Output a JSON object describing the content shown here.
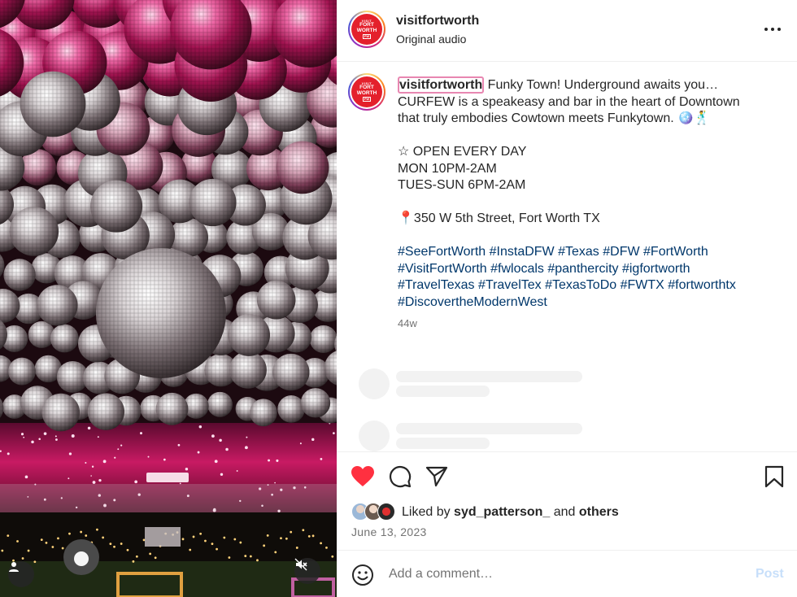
{
  "header": {
    "username": "visitfortworth",
    "audio": "Original audio",
    "more_icon": "more-horizontal-icon"
  },
  "avatar": {
    "line1": "VISIT",
    "line2": "FORT",
    "line3": "WORTH",
    "line4": "FW",
    "color": "#e4202c"
  },
  "caption": {
    "username": "visitfortworth",
    "line1": " Funky Town! Underground awaits you…",
    "line2": "CURFEW is a speakeasy and bar in the heart of Downtown",
    "line3": "that truly embodies Cowtown meets Funkytown. 🪩🕺",
    "line4": "☆ OPEN EVERY DAY",
    "line5": "MON 10PM-2AM",
    "line6": "TUES-SUN 6PM-2AM",
    "line7": "📍350 W 5th Street, Fort Worth TX",
    "hashtags1": "#SeeFortWorth #InstaDFW #Texas #DFW #FortWorth",
    "hashtags2": "#VisitFortWorth #fwlocals #panthercity #igfortworth",
    "hashtags3": "#TravelTexas #TravelTex #TexasToDo #FWTX #fortworthtx",
    "hashtags4": "#DiscovertheModernWest",
    "time_ago": "44w"
  },
  "actions": {
    "like_icon": "heart-filled-icon",
    "comment_icon": "comment-icon",
    "share_icon": "send-icon",
    "save_icon": "bookmark-icon",
    "like_color": "#ff3040"
  },
  "likes": {
    "prefix": "Liked by ",
    "user": "syd_patterson_",
    "middle": " and ",
    "others": "others"
  },
  "date": "June 13, 2023",
  "comment": {
    "placeholder": "Add a comment…",
    "post_label": "Post",
    "emoji_icon": "emoji-icon"
  },
  "media": {
    "user_tag_icon": "user-tag-icon",
    "mute_icon": "volume-muted-icon",
    "accent_color": "#e8217a"
  }
}
